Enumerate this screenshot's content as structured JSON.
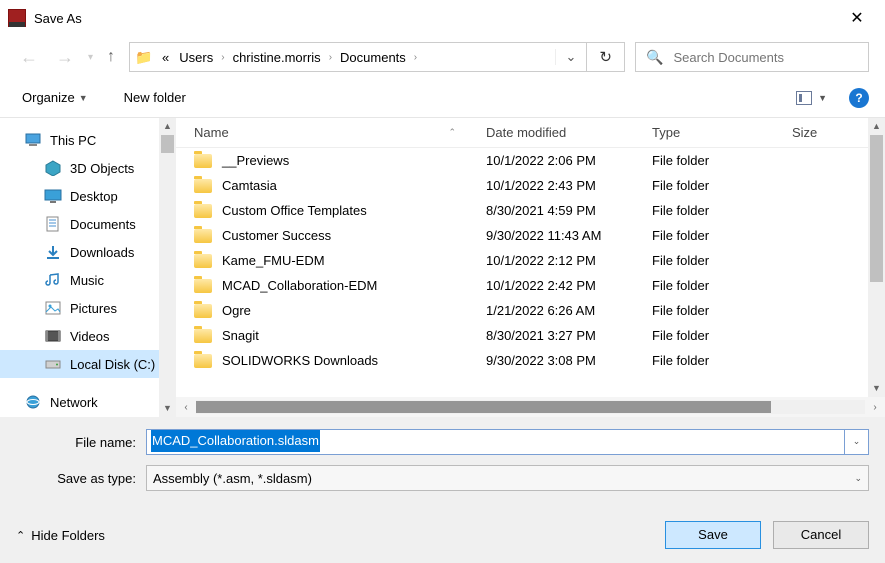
{
  "titlebar": {
    "title": "Save As"
  },
  "nav": {
    "breadcrumb_lead": "«",
    "segments": [
      "Users",
      "christine.morris",
      "Documents"
    ],
    "search_placeholder": "Search Documents"
  },
  "toolbar": {
    "organize": "Organize",
    "new_folder": "New folder",
    "help": "?"
  },
  "sidebar": {
    "items": [
      {
        "label": "This PC",
        "icon": "pc",
        "sub": false
      },
      {
        "label": "3D Objects",
        "icon": "3d",
        "sub": true
      },
      {
        "label": "Desktop",
        "icon": "desktop",
        "sub": true
      },
      {
        "label": "Documents",
        "icon": "documents",
        "sub": true
      },
      {
        "label": "Downloads",
        "icon": "downloads",
        "sub": true
      },
      {
        "label": "Music",
        "icon": "music",
        "sub": true
      },
      {
        "label": "Pictures",
        "icon": "pictures",
        "sub": true
      },
      {
        "label": "Videos",
        "icon": "videos",
        "sub": true
      },
      {
        "label": "Local Disk (C:)",
        "icon": "disk",
        "sub": true,
        "selected": true
      },
      {
        "label": "Network",
        "icon": "network",
        "sub": false,
        "sep": true
      }
    ]
  },
  "columns": {
    "name": "Name",
    "date": "Date modified",
    "type": "Type",
    "size": "Size"
  },
  "files": [
    {
      "name": "__Previews",
      "date": "10/1/2022 2:06 PM",
      "type": "File folder"
    },
    {
      "name": "Camtasia",
      "date": "10/1/2022 2:43 PM",
      "type": "File folder"
    },
    {
      "name": "Custom Office Templates",
      "date": "8/30/2021 4:59 PM",
      "type": "File folder"
    },
    {
      "name": "Customer Success",
      "date": "9/30/2022 11:43 AM",
      "type": "File folder"
    },
    {
      "name": "Kame_FMU-EDM",
      "date": "10/1/2022 2:12 PM",
      "type": "File folder"
    },
    {
      "name": "MCAD_Collaboration-EDM",
      "date": "10/1/2022 2:42 PM",
      "type": "File folder"
    },
    {
      "name": "Ogre",
      "date": "1/21/2022 6:26 AM",
      "type": "File folder"
    },
    {
      "name": "Snagit",
      "date": "8/30/2021 3:27 PM",
      "type": "File folder"
    },
    {
      "name": "SOLIDWORKS Downloads",
      "date": "9/30/2022 3:08 PM",
      "type": "File folder"
    }
  ],
  "form": {
    "filename_label": "File name:",
    "filename_value": "MCAD_Collaboration.sldasm",
    "savetype_label": "Save as type:",
    "savetype_value": "Assembly (*.asm, *.sldasm)"
  },
  "footer": {
    "hide_folders": "Hide Folders",
    "save": "Save",
    "cancel": "Cancel"
  }
}
